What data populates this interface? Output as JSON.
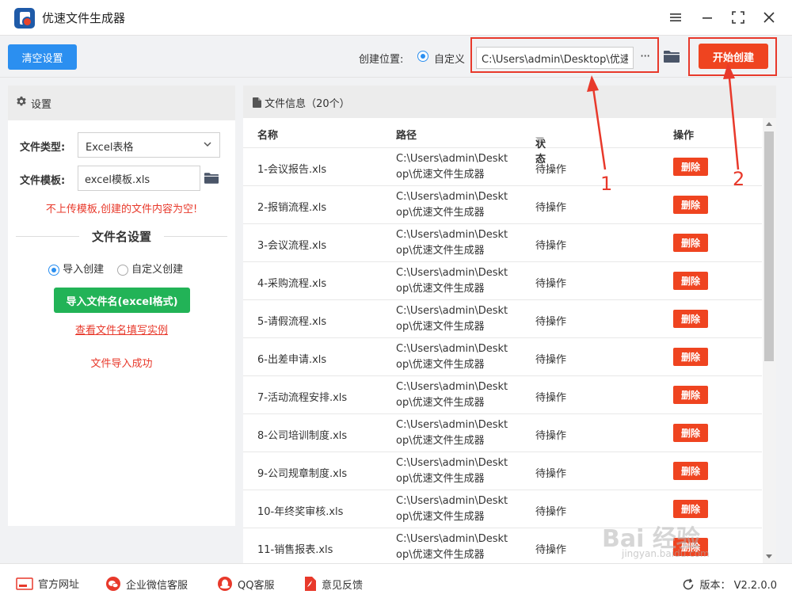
{
  "window": {
    "title": "优速文件生成器"
  },
  "toolbar": {
    "clear_label": "清空设置",
    "location_label": "创建位置:",
    "custom_label": "自定义",
    "path_value": "C:\\Users\\admin\\Desktop\\优速",
    "more_label": "···",
    "start_label": "开始创建"
  },
  "settings": {
    "header": "设置",
    "file_type_label": "文件类型:",
    "file_type_value": "Excel表格",
    "template_label": "文件模板:",
    "template_value": "excel模板.xls",
    "warning": "不上传模板,创建的文件内容为空!",
    "filename_section": "文件名设置",
    "import_create_label": "导入创建",
    "custom_create_label": "自定义创建",
    "import_button": "导入文件名(excel格式)",
    "example_link": "查看文件名填写实例",
    "import_status": "文件导入成功"
  },
  "file_info": {
    "header": "文件信息（20个）",
    "columns": {
      "name": "名称",
      "path": "路径",
      "status": "状态",
      "action": "操作"
    },
    "rows": [
      {
        "name": "1-会议报告.xls",
        "path_line1": "C:\\Users\\admin\\Deskt",
        "path_line2": "op\\优速文件生成器",
        "status": "待操作",
        "action": "删除"
      },
      {
        "name": "2-报销流程.xls",
        "path_line1": "C:\\Users\\admin\\Deskt",
        "path_line2": "op\\优速文件生成器",
        "status": "待操作",
        "action": "删除"
      },
      {
        "name": "3-会议流程.xls",
        "path_line1": "C:\\Users\\admin\\Deskt",
        "path_line2": "op\\优速文件生成器",
        "status": "待操作",
        "action": "删除"
      },
      {
        "name": "4-采购流程.xls",
        "path_line1": "C:\\Users\\admin\\Deskt",
        "path_line2": "op\\优速文件生成器",
        "status": "待操作",
        "action": "删除"
      },
      {
        "name": "5-请假流程.xls",
        "path_line1": "C:\\Users\\admin\\Deskt",
        "path_line2": "op\\优速文件生成器",
        "status": "待操作",
        "action": "删除"
      },
      {
        "name": "6-出差申请.xls",
        "path_line1": "C:\\Users\\admin\\Deskt",
        "path_line2": "op\\优速文件生成器",
        "status": "待操作",
        "action": "删除"
      },
      {
        "name": "7-活动流程安排.xls",
        "path_line1": "C:\\Users\\admin\\Deskt",
        "path_line2": "op\\优速文件生成器",
        "status": "待操作",
        "action": "删除"
      },
      {
        "name": "8-公司培训制度.xls",
        "path_line1": "C:\\Users\\admin\\Deskt",
        "path_line2": "op\\优速文件生成器",
        "status": "待操作",
        "action": "删除"
      },
      {
        "name": "9-公司规章制度.xls",
        "path_line1": "C:\\Users\\admin\\Deskt",
        "path_line2": "op\\优速文件生成器",
        "status": "待操作",
        "action": "删除"
      },
      {
        "name": "10-年终奖审核.xls",
        "path_line1": "C:\\Users\\admin\\Deskt",
        "path_line2": "op\\优速文件生成器",
        "status": "待操作",
        "action": "删除"
      },
      {
        "name": "11-销售报表.xls",
        "path_line1": "C:\\Users\\admin\\Deskt",
        "path_line2": "op\\优速文件生成器",
        "status": "待操作",
        "action": "删除"
      }
    ]
  },
  "footer": {
    "website": "官方网址",
    "wechat": "企业微信客服",
    "qq": "QQ客服",
    "feedback": "意见反馈",
    "version": "版本：  V2.2.0.0"
  },
  "annotations": {
    "label1": "1",
    "label2": "2"
  },
  "watermark": {
    "brand": "Bai 经验",
    "url": "jingyan.baidu.com"
  },
  "colors": {
    "primary": "#2b8ff0",
    "danger": "#ef4420",
    "success": "#22b357",
    "annotation": "#e8392b"
  },
  "icons": [
    "menu-icon",
    "minimize-icon",
    "maximize-icon",
    "close-icon",
    "gear-icon",
    "folder-icon",
    "chevron-down-icon",
    "filter-icon",
    "document-icon",
    "refresh-icon"
  ]
}
